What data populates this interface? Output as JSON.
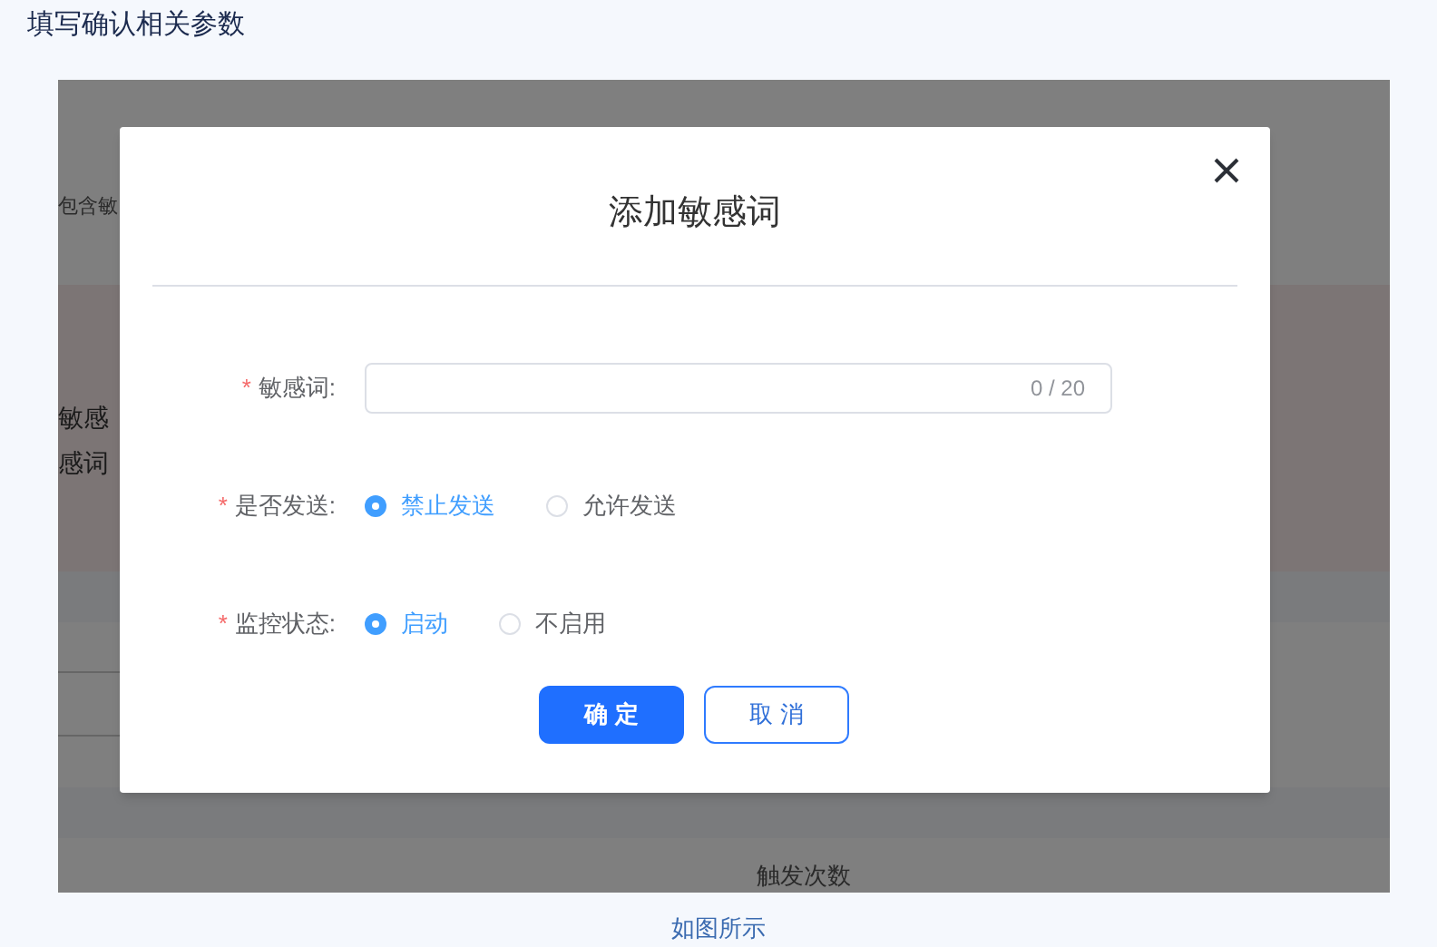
{
  "page_title": "填写确认相关参数",
  "background": {
    "texts": [
      "包含敏",
      "敏感",
      "感词"
    ],
    "column_header": "触发次数"
  },
  "dialog": {
    "title": "添加敏感词",
    "word_field": {
      "label": "敏感词:",
      "required_mark": "*",
      "counter": "0 / 20"
    },
    "radio_groups": [
      {
        "label": "是否发送:",
        "required_mark": "*",
        "options": [
          {
            "label": "禁止发送",
            "selected": true
          },
          {
            "label": "允许发送",
            "selected": false
          }
        ]
      },
      {
        "label": "监控状态:",
        "required_mark": "*",
        "options": [
          {
            "label": "启动",
            "selected": true
          },
          {
            "label": "不启用",
            "selected": false
          }
        ]
      }
    ],
    "buttons": [
      {
        "kind": "primary",
        "label": "确 定"
      },
      {
        "kind": "secondary",
        "label": "取 消"
      }
    ]
  },
  "caption": "如图所示"
}
